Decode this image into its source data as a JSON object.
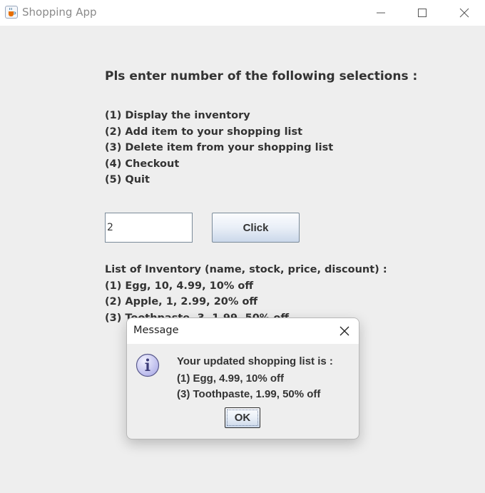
{
  "window": {
    "title": "Shopping App"
  },
  "main": {
    "heading": "Pls enter number of the following selections :",
    "menu_options": [
      "(1) Display the inventory",
      "(2) Add item to your shopping list",
      "(3) Delete item from your shopping list",
      "(4) Checkout",
      "(5) Quit"
    ],
    "selection_input": {
      "value": "2"
    },
    "click_button_label": "Click",
    "inventory": [
      "List of Inventory (name, stock, price, discount) :",
      "(1) Egg, 10, 4.99, 10% off",
      "(2) Apple, 1, 2.99, 20% off",
      "(3) Toothpaste, 3, 1.99, 50% off"
    ]
  },
  "dialog": {
    "title": "Message",
    "message_lines": [
      "Your updated shopping list is :",
      "(1) Egg, 4.99, 10% off",
      "(3) Toothpaste, 1.99, 50% off"
    ],
    "ok_label": "OK"
  },
  "icons": {
    "app": "java-coffee-cup-icon",
    "minimize": "minimize-icon",
    "maximize": "maximize-icon",
    "close": "close-icon",
    "info": "info-icon"
  },
  "colors": {
    "window_background": "#eeeeee",
    "title_bar": "#ffffff",
    "text": "#333333",
    "button_gradient_top": "#fbfcfe",
    "button_gradient_bottom": "#cbd8ea",
    "info_icon_fill": "#c8c8f0"
  }
}
